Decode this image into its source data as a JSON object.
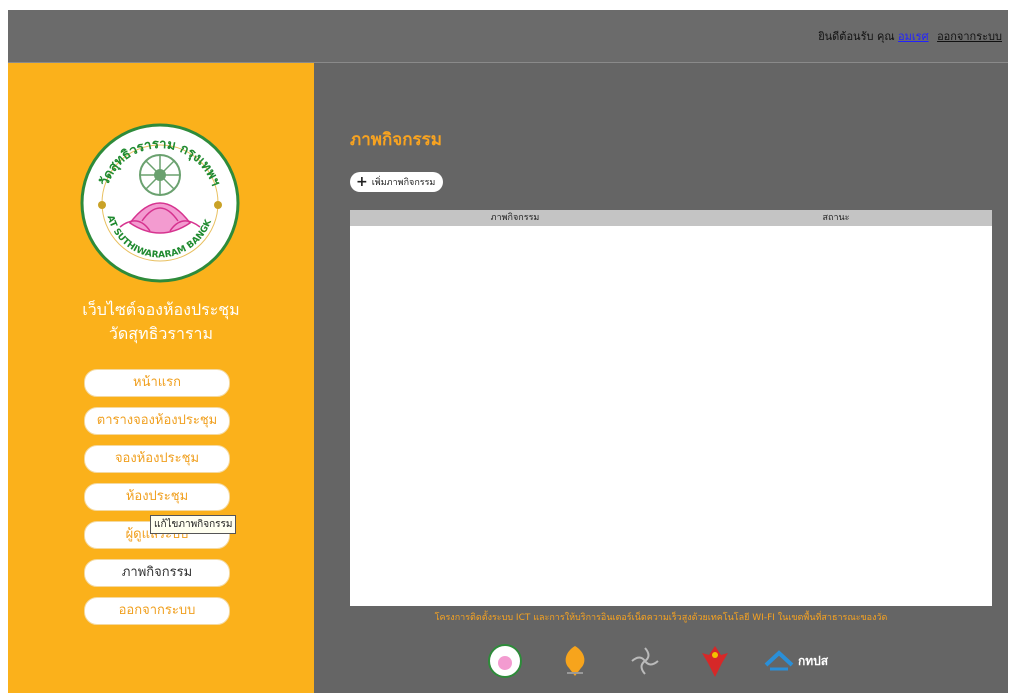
{
  "header": {
    "welcome_text": "ยินดีต้อนรับ คุณ",
    "user_name": "อมเรศ",
    "logout_label": "ออกจากระบบ"
  },
  "sidebar": {
    "logo_text_top": "วัดสุทธิวราราม กรุงเทพฯ",
    "logo_text_bottom": "WAT SUTHIWARARAM BANGKOK",
    "site_title_line1": "เว็บไซต์จองห้องประชุม",
    "site_title_line2": "วัดสุทธิวราราม",
    "items": [
      {
        "label": "หน้าแรก"
      },
      {
        "label": "ตารางจองห้องประชุม"
      },
      {
        "label": "จองห้องประชุม"
      },
      {
        "label": "ห้องประชุม"
      },
      {
        "label": "ผู้ดูแลระบบ"
      },
      {
        "label": "ภาพกิจกรรม"
      },
      {
        "label": "ออกจากระบบ"
      }
    ],
    "tooltip": "แก้ไขภาพกิจกรรม"
  },
  "main": {
    "title": "ภาพกิจกรรม",
    "add_button": "เพิ่มภาพกิจกรรม",
    "add_icon": "plus-icon",
    "table": {
      "columns": [
        "ภาพกิจกรรม",
        "สถานะ"
      ],
      "rows": []
    }
  },
  "footer": {
    "note": "โครงการติดตั้งระบบ ICT และการให้บริการอินเตอร์เน็ตความเร็วสูงด้วยเทคโนโลยี WI-FI ในเขตพื้นที่สาธารณะของวัด",
    "partner_label": "กทปส"
  },
  "colors": {
    "sidebar_bg": "#fbb11b",
    "main_bg": "#656565",
    "accent": "#f8a320"
  }
}
